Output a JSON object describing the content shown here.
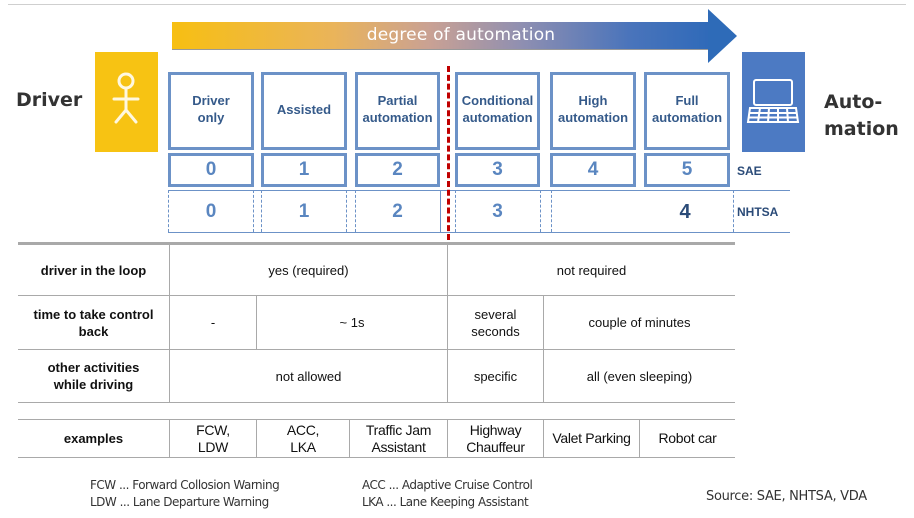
{
  "arrow": {
    "label": "degree of automation",
    "start_color": "#f7bf12",
    "end_color": "#2e6bb8"
  },
  "left_actor": {
    "label": "Driver",
    "icon": "stick-figure-icon",
    "tile_color": "#f7c313"
  },
  "right_actor": {
    "label_line1": "Auto-",
    "label_line2": "mation",
    "icon": "laptop-icon",
    "tile_color": "#4c7ac3"
  },
  "levels": [
    {
      "name_line1": "Driver",
      "name_line2": "only",
      "sae": "0"
    },
    {
      "name_line1": "Assisted",
      "name_line2": "",
      "sae": "1"
    },
    {
      "name_line1": "Partial",
      "name_line2": "automation",
      "sae": "2"
    },
    {
      "name_line1": "Conditional",
      "name_line2": "automation",
      "sae": "3"
    },
    {
      "name_line1": "High",
      "name_line2": "automation",
      "sae": "4"
    },
    {
      "name_line1": "Full",
      "name_line2": "automation",
      "sae": "5"
    }
  ],
  "standards": {
    "sae_label": "SAE",
    "nhtsa_label": "NHTSA"
  },
  "nhtsa_levels": [
    "0",
    "1",
    "2",
    "3",
    "4"
  ],
  "table": {
    "rows": [
      {
        "header": "driver in the loop",
        "cells": [
          "yes (required)",
          "not required"
        ]
      },
      {
        "header": "time to take control back",
        "cells": [
          "-",
          "~ 1s",
          "several seconds",
          "couple of minutes"
        ]
      },
      {
        "header": "other activities while driving",
        "cells": [
          "not allowed",
          "specific",
          "all (even sleeping)"
        ]
      }
    ],
    "examples": {
      "header": "examples",
      "cells": [
        [
          "FCW,",
          "LDW"
        ],
        [
          "ACC,",
          "LKA"
        ],
        [
          "Traffic Jam",
          "Assistant"
        ],
        [
          "Highway",
          "Chauffeur"
        ],
        [
          "Valet Parking",
          ""
        ],
        [
          "Robot car",
          ""
        ]
      ]
    }
  },
  "legend": {
    "col1": [
      "FCW ... Forward Collosion Warning",
      "LDW ... Lane Departure Warning"
    ],
    "col2": [
      "ACC ... Adaptive Cruise Control",
      "LKA ... Lane Keeping Assistant"
    ]
  },
  "source": "Source: SAE, NHTSA, VDA"
}
